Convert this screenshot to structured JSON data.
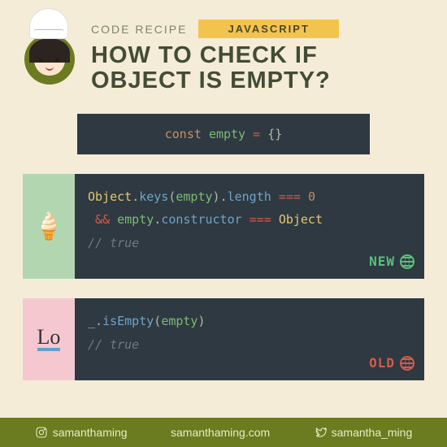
{
  "header": {
    "recipe_label": "CODE RECIPE",
    "language_badge": "JAVASCRIPT",
    "title_line1": "HOW TO CHECK IF",
    "title_line2": "OBJECT IS EMPTY?"
  },
  "block1": {
    "kw": "const",
    "name": "empty",
    "eq": "=",
    "braces": "{}"
  },
  "section_new": {
    "icon": "🍦",
    "line1": {
      "obj": "Object",
      "dot1": ".",
      "keys": "keys",
      "open": "(",
      "arg": "empty",
      "close": ")",
      "dot2": ".",
      "len": "length",
      "op": " === ",
      "zero": "0"
    },
    "line2": {
      "and": "&&",
      "arg": " empty",
      "dot": ".",
      "ctor": "constructor",
      "op": " === ",
      "cls": "Object"
    },
    "comment": "// true",
    "badge": "NEW"
  },
  "section_old": {
    "icon": "Lo",
    "line1": {
      "us": "_",
      "dot": ".",
      "fn": "isEmpty",
      "open": "(",
      "arg": "empty",
      "close": ")"
    },
    "comment": "// true",
    "badge": "OLD"
  },
  "footer": {
    "instagram": "samanthaming",
    "website": "samanthaming.com",
    "twitter": "samantha_ming"
  }
}
